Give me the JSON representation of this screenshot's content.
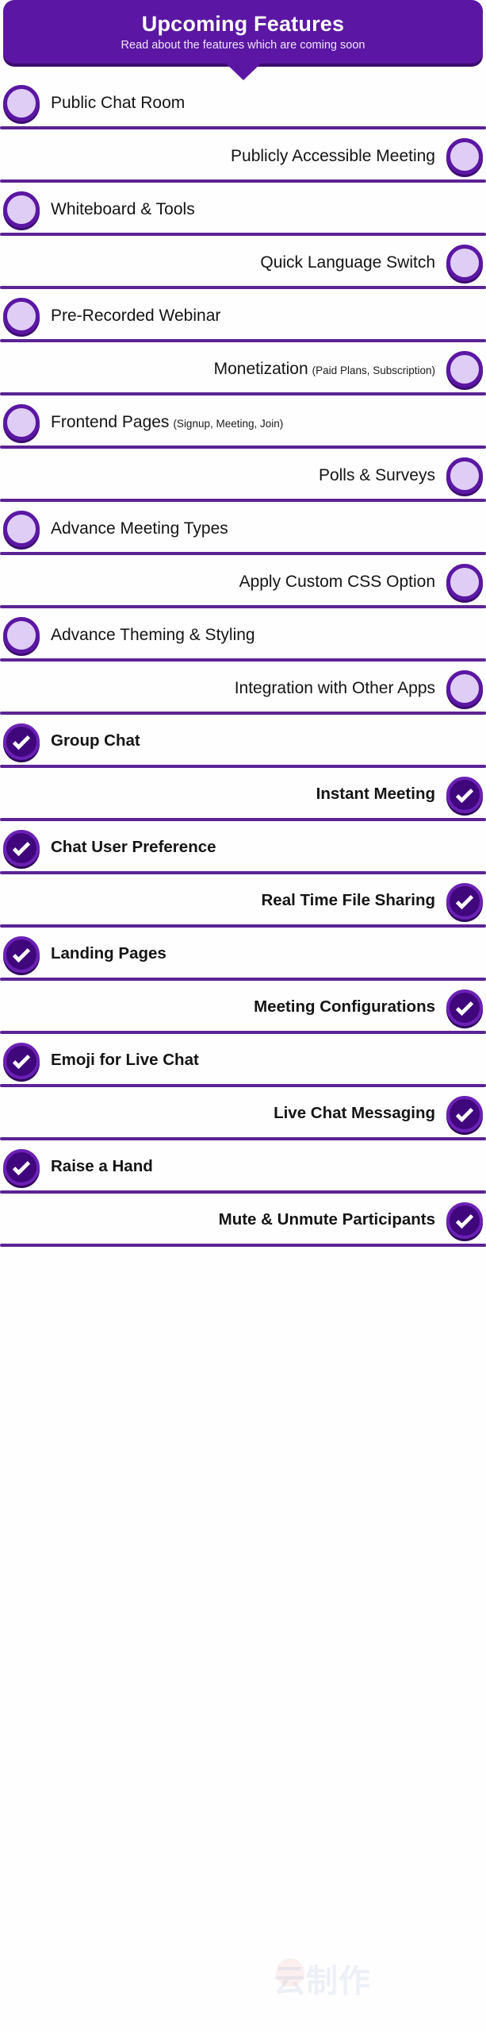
{
  "header": {
    "title": "Upcoming Features",
    "subtitle": "Read about the features which are coming soon",
    "pointer_icon": "triangle-down-icon",
    "background_color": "#5b17a3",
    "title_color": "#ffffff"
  },
  "theme": {
    "accent": "#5b17a3",
    "rule_color": "#5b2394",
    "open_marker_fill": "#dfcdf5",
    "done_marker_fill": "#40077d",
    "text_color": "#141414"
  },
  "legend": {
    "open_icon": "empty-circle-icon",
    "done_icon": "check-circle-icon"
  },
  "watermark": {
    "text": "云制作"
  },
  "features": [
    {
      "label": "Public Chat Room",
      "sub": "",
      "status": "upcoming",
      "side": "left"
    },
    {
      "label": "Publicly Accessible Meeting",
      "sub": "",
      "status": "upcoming",
      "side": "right"
    },
    {
      "label": "Whiteboard & Tools",
      "sub": "",
      "status": "upcoming",
      "side": "left"
    },
    {
      "label": "Quick Language Switch",
      "sub": "",
      "status": "upcoming",
      "side": "right"
    },
    {
      "label": "Pre-Recorded Webinar",
      "sub": "",
      "status": "upcoming",
      "side": "left"
    },
    {
      "label": "Monetization",
      "sub": "(Paid Plans, Subscription)",
      "status": "upcoming",
      "side": "right"
    },
    {
      "label": "Frontend Pages",
      "sub": "(Signup, Meeting, Join)",
      "status": "upcoming",
      "side": "left"
    },
    {
      "label": "Polls & Surveys",
      "sub": "",
      "status": "upcoming",
      "side": "right"
    },
    {
      "label": "Advance Meeting Types",
      "sub": "",
      "status": "upcoming",
      "side": "left"
    },
    {
      "label": "Apply Custom CSS Option",
      "sub": "",
      "status": "upcoming",
      "side": "right"
    },
    {
      "label": "Advance Theming & Styling",
      "sub": "",
      "status": "upcoming",
      "side": "left"
    },
    {
      "label": "Integration with Other Apps",
      "sub": "",
      "status": "upcoming",
      "side": "right"
    },
    {
      "label": "Group Chat",
      "sub": "",
      "status": "done",
      "side": "left"
    },
    {
      "label": "Instant Meeting",
      "sub": "",
      "status": "done",
      "side": "right"
    },
    {
      "label": "Chat User Preference",
      "sub": "",
      "status": "done",
      "side": "left"
    },
    {
      "label": "Real Time File Sharing",
      "sub": "",
      "status": "done",
      "side": "right"
    },
    {
      "label": "Landing Pages",
      "sub": "",
      "status": "done",
      "side": "left"
    },
    {
      "label": "Meeting Configurations",
      "sub": "",
      "status": "done",
      "side": "right"
    },
    {
      "label": "Emoji for Live Chat",
      "sub": "",
      "status": "done",
      "side": "left"
    },
    {
      "label": "Live Chat Messaging",
      "sub": "",
      "status": "done",
      "side": "right"
    },
    {
      "label": "Raise a Hand",
      "sub": "",
      "status": "done",
      "side": "left"
    },
    {
      "label": "Mute & Unmute Participants",
      "sub": "",
      "status": "done",
      "side": "right"
    }
  ]
}
